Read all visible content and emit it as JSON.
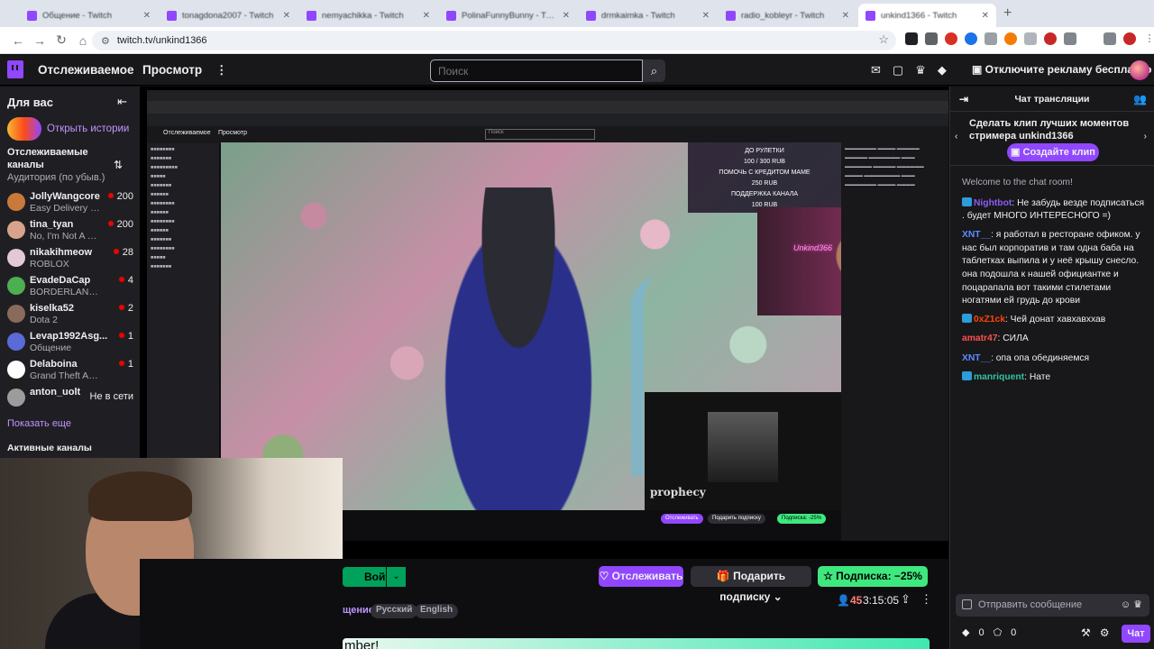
{
  "browser": {
    "tabs": [
      {
        "title": "Общение - Twitch",
        "active": false
      },
      {
        "title": "tonagdona2007 - Twitch",
        "active": false
      },
      {
        "title": "nemyachikka - Twitch",
        "active": false
      },
      {
        "title": "PolinaFunnyBunny - Twitch",
        "active": false
      },
      {
        "title": "drmkaimka - Twitch",
        "active": false
      },
      {
        "title": "radio_kobleyr - Twitch",
        "active": false
      },
      {
        "title": "unkind1366 - Twitch",
        "active": true
      }
    ],
    "url": "twitch.tv/unkind1366"
  },
  "topnav": {
    "following": "Отслеживаемое",
    "browse": "Просмотр",
    "more": "⋮",
    "search_placeholder": "Поиск",
    "ad_free": "Отключите рекламу бесплатно"
  },
  "sidebar": {
    "title": "Для вас",
    "stories": "Открыть истории",
    "followed_title": "Отслеживаемые каналы",
    "sort_label": "Аудитория (по убыв.)",
    "channels": [
      {
        "name": "JollyWangcore",
        "game": "Easy Delivery C...",
        "viewers": "200",
        "color": "#c97a3b"
      },
      {
        "name": "tina_tyan",
        "game": "No, I'm Not A H...",
        "viewers": "200",
        "color": "#d7a38a"
      },
      {
        "name": "nikakihmeow",
        "game": "ROBLOX",
        "viewers": "28",
        "color": "#e3c9d6"
      },
      {
        "name": "EvadeDaCap",
        "game": "BORDERLAND...",
        "viewers": "4",
        "color": "#4caf50"
      },
      {
        "name": "kiselka52",
        "game": "Dota 2",
        "viewers": "2",
        "color": "#8a6a5a"
      },
      {
        "name": "Levap1992Asg...",
        "game": "Общение",
        "viewers": "1",
        "color": "#5a6bd7"
      },
      {
        "name": "Delaboina",
        "game": "Grand Theft Au...",
        "viewers": "1",
        "color": "#ffffff"
      },
      {
        "name": "anton_uolt",
        "game": "",
        "viewers": "",
        "offline": "Не в сети",
        "color": "#9c9c9c"
      }
    ],
    "show_more": "Показать еще",
    "active_channels": "Активные каналы"
  },
  "video": {
    "inner_overlay_lines": [
      "ДО РУЛЕТКИ",
      "100 / 300 RUB",
      "ПОМОЧЬ С КРЕДИТОМ МАМЕ",
      "250 RUB",
      "ПОДДЕРЖКА КАНАЛА",
      "100 RUB"
    ],
    "neon_text": "Unkind366",
    "video_label": "prophecy",
    "inner_nav_following": "Отслеживаемое",
    "inner_nav_browse": "Просмотр",
    "inner_search": "Поиск",
    "inner_follow": "Отслеживать",
    "inner_gift": "Подарить подписку",
    "inner_sub": "Подписка: -25%"
  },
  "actions": {
    "join": "Войти",
    "follow": "Отслеживать",
    "gift": "Подарить подписку",
    "subscribe": "Подписка: −25%",
    "viewers": "45",
    "uptime": "3:15:05",
    "category": "щение",
    "tags": [
      "Русский",
      "English"
    ],
    "banner_text": "mber!"
  },
  "chat": {
    "title": "Чат трансляции",
    "clip_text": "Сделать клип лучших моментов стримера unkind1366",
    "clip_button": "Создайте клип",
    "welcome": "Welcome to the chat room!",
    "messages": [
      {
        "user": "Nightbot",
        "color": "#8a5cf5",
        "text": "Не забудь везде подписаться . будет МНОГО ИНТЕРЕСНОГО =)",
        "badge": true
      },
      {
        "user": "XNT__",
        "color": "#5a8cff",
        "text": "я работал в ресторане офиком. у нас был корпоратив и там одна баба на таблетках выпила и у неё крышу снесло. она подошла к нашей официантке и поцарапала вот такими стилетами ногатями ей грудь до крови",
        "badge": false
      },
      {
        "user": "0xZ1ck",
        "color": "#ff4500",
        "text": "Чей донат хавхавххав",
        "badge": true
      },
      {
        "user": "amatr47",
        "color": "#ff4f4f",
        "text": "СИЛА",
        "badge": false
      },
      {
        "user": "XNT__",
        "color": "#5a8cff",
        "text": "опа опа обединяемся",
        "badge": false
      },
      {
        "user": "manriquent",
        "color": "#32c3a2",
        "text": "Нате",
        "badge": true
      }
    ],
    "input_placeholder": "Отправить сообщение",
    "points": "0",
    "bits": "0",
    "send": "Чат"
  }
}
